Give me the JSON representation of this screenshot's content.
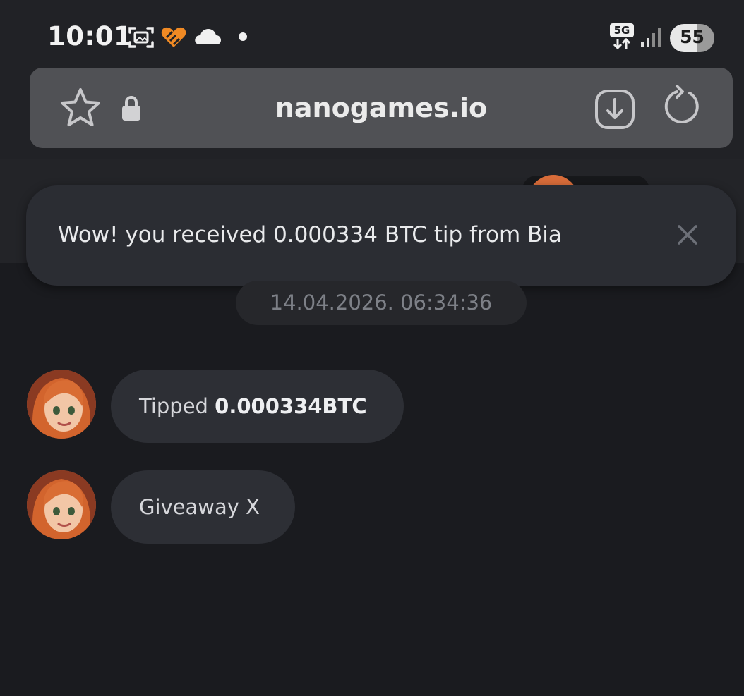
{
  "status_bar": {
    "time": "10:01",
    "network_label": "5G",
    "battery_level": "55",
    "battery_fraction": 0.55,
    "icons": [
      "screenshot-icon",
      "heart-icon",
      "cloud-icon",
      "dot-icon",
      "network-5g-icon",
      "signal-icon",
      "battery-icon"
    ]
  },
  "browser": {
    "url": "nanogames.io",
    "icons": [
      "star-icon",
      "lock-icon",
      "download-icon",
      "reload-icon"
    ]
  },
  "toast": {
    "message": "Wow! you received 0.000334 BTC tip from Bia",
    "close_icon": "close-icon"
  },
  "chat": {
    "date_separator": "14.04.2026. 06:34:36",
    "messages": [
      {
        "prefix": "Tipped ",
        "bold": "0.000334BTC"
      },
      {
        "prefix": "Giveaway X",
        "bold": ""
      }
    ]
  },
  "colors": {
    "background": "#1a1b1f",
    "toast_bg": "#2b2d33",
    "bubble_bg": "#2d2f35",
    "url_bar_bg": "#505155",
    "accent_orange": "#f08a24"
  }
}
